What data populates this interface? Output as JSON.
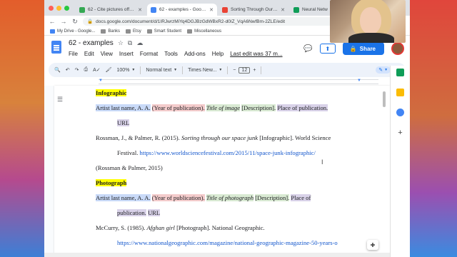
{
  "browser": {
    "tabs": [
      {
        "title": "62 - Cite pictures off the inte",
        "favicon_color": "#34a853",
        "active": false
      },
      {
        "title": "62 - examples - Google Docs",
        "favicon_color": "#4285f4",
        "active": true
      },
      {
        "title": "Sorting Through Our Space Jun",
        "favicon_color": "#ea4335",
        "active": false
      },
      {
        "title": "Neural Netw",
        "favicon_color": "#0f9d58",
        "active": false
      }
    ],
    "url": "docs.google.com/document/d/1IRJwrzMiYq4DGJBzGdWBxR2-d0IZ_VqA6NwfBm-2ZLE/edit",
    "bookmarks": [
      "My Drive - Google...",
      "Banks",
      "Etsy",
      "Smart Student",
      "Miscellaneous"
    ]
  },
  "docs": {
    "title": "62 - examples",
    "menus": [
      "File",
      "Edit",
      "View",
      "Insert",
      "Format",
      "Tools",
      "Add-ons",
      "Help"
    ],
    "last_edit": "Last edit was 37 m...",
    "share_label": "Share",
    "toolbar": {
      "zoom": "100%",
      "style": "Normal text",
      "font": "Times New...",
      "font_size": "12",
      "minus": "−",
      "plus": "+"
    }
  },
  "document": {
    "heading1": "Infographic",
    "template1": {
      "author": "Artist last name, A. A.",
      "year": "(Year of publication).",
      "title": "Title of image",
      "desc": "[Description].",
      "place": "Place of publication.",
      "url": "URL"
    },
    "ref1_line1_a": "Rossman, J., & Palmer, R. (2015). ",
    "ref1_title": "Sorting through our space junk",
    "ref1_line1_b": " [Infographic]. World Science",
    "ref1_line2_a": "Festival. ",
    "ref1_url": "https://www.worldsciencefestival.com/2015/11/space-junk-infographic/",
    "intext1": "(Rossman & Palmer, 2015)",
    "heading2": "Photograph",
    "template2": {
      "author": "Artist last name, A. A.",
      "year": "(Year of publication).",
      "title": "Title of photograph",
      "desc": "[Description].",
      "place": "Place of",
      "place2": "publication.",
      "url": "URL"
    },
    "ref2_line1_a": "McCurry, S. (1985). ",
    "ref2_title": "Afghan girl",
    "ref2_line1_b": " [Photograph]. National Geographic.",
    "ref2_url": "https://www.nationalgeographic.com/magazine/national-geographic-magazine-50-years-o"
  },
  "colors": {
    "accent": "#1a73e8",
    "highlight_yellow": "#ffff00",
    "highlight_blue": "#c9daf8",
    "highlight_red": "#f4cccc",
    "highlight_green": "#d9ead3",
    "highlight_purple": "#d9d2e9"
  }
}
